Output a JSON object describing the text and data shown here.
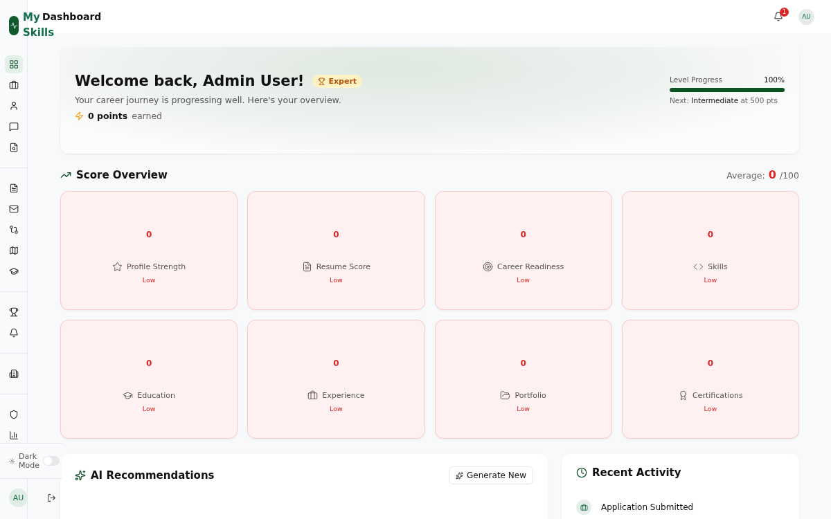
{
  "sidebar": {
    "logo_lines": [
      "My",
      "Skills"
    ],
    "nav_groups": [
      [
        {
          "selected": true
        },
        {
          "selected": false
        },
        {
          "selected": false
        },
        {
          "selected": false
        },
        {
          "selected": false
        }
      ],
      [
        {
          "selected": false
        },
        {
          "selected": false
        },
        {
          "selected": false
        },
        {
          "selected": false
        },
        {
          "selected": false
        }
      ],
      [
        {
          "selected": false
        },
        {
          "selected": false
        }
      ],
      [
        {
          "selected": false
        }
      ],
      [
        {
          "selected": false
        },
        {
          "selected": false
        }
      ]
    ],
    "dark_mode": {
      "label": "Dark Mode",
      "on": false
    },
    "avatar": "AU"
  },
  "header": {
    "title": "Dashboard",
    "notification_count": "1",
    "avatar": "AU"
  },
  "hero": {
    "title": "Welcome back, Admin User!",
    "badge": "Expert",
    "subtitle": "Your career journey is progressing well. Here's your overview.",
    "points": "0 points",
    "points_suffix": "earned",
    "progress": {
      "label": "Level Progress",
      "percent": "100%",
      "level": 1,
      "next": "Next: **Intermediate** at 500 pts"
    }
  },
  "score_overview": {
    "title": "Score Overview",
    "average_label": "Average:",
    "average_value": "0",
    "average_max": "/100",
    "cards": [
      {
        "value": "0",
        "label": "Profile Strength",
        "rating": "Low"
      },
      {
        "value": "0",
        "label": "Resume Score",
        "rating": "Low"
      },
      {
        "value": "0",
        "label": "Career Readiness",
        "rating": "Low"
      },
      {
        "value": "0",
        "label": "Skills",
        "rating": "Low"
      },
      {
        "value": "0",
        "label": "Education",
        "rating": "Low"
      },
      {
        "value": "0",
        "label": "Experience",
        "rating": "Low"
      },
      {
        "value": "0",
        "label": "Portfolio",
        "rating": "Low"
      },
      {
        "value": "0",
        "label": "Certifications",
        "rating": "Low"
      }
    ]
  },
  "ai_recommendations": {
    "title": "AI Recommendations",
    "button": "Generate New"
  },
  "recent_activity": {
    "title": "Recent Activity",
    "items": [
      {
        "title": "Application Submitted"
      }
    ]
  }
}
